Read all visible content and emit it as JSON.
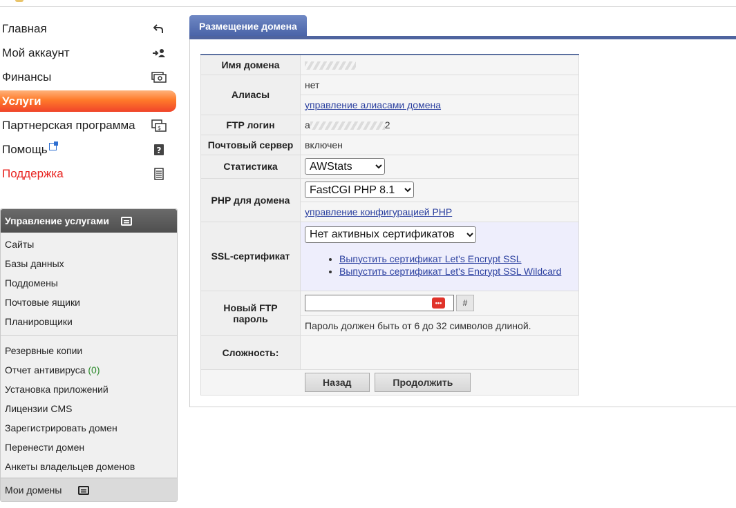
{
  "nav": {
    "items": [
      {
        "label": "Главная",
        "icon": "back-arrow-icon"
      },
      {
        "label": "Мой аккаунт",
        "icon": "user-login-icon"
      },
      {
        "label": "Финансы",
        "icon": "cash-icon"
      },
      {
        "label": "Услуги",
        "icon": "",
        "active": true
      },
      {
        "label": "Партнерская программа",
        "icon": "partner-icon"
      },
      {
        "label": "Помощь",
        "icon": "help-icon",
        "external": true
      },
      {
        "label": "Поддержка",
        "icon": "document-icon",
        "color": "#e8231f"
      }
    ]
  },
  "services": {
    "title": "Управление услугами",
    "group1": [
      "Сайты",
      "Базы данных",
      "Поддомены",
      "Почтовые ящики",
      "Планировщики"
    ],
    "group2": [
      "Резервные копии",
      "Отчет антивируса",
      "Установка приложений",
      "Лицензии CMS",
      "Зарегистрировать домен",
      "Перенести домен",
      "Анкеты владельцев доменов"
    ],
    "antivirus_count": "(0)",
    "footer": "Мои домены"
  },
  "tab": {
    "title": "Размещение домена"
  },
  "form": {
    "domain_label": "Имя домена",
    "aliases_label": "Алиасы",
    "aliases_value": "нет",
    "aliases_link": "управление алиасами домена",
    "ftp_login_label": "FTP логин",
    "ftp_login_prefix": "a",
    "ftp_login_suffix": "2",
    "mail_label": "Почтовый сервер",
    "mail_value": "включен",
    "stats_label": "Статистика",
    "stats_selected": "AWStats",
    "php_label": "PHP для домена",
    "php_selected": "FastCGI PHP 8.1",
    "php_link": "управление конфигурацией PHP",
    "ssl_label": "SSL-сертификат",
    "ssl_selected": "Нет активных сертификатов",
    "ssl_links": [
      "Выпустить сертификат Let's Encrypt SSL",
      "Выпустить сертификат Let's Encrypt SSL Wildcard"
    ],
    "ftp_pwd_label": "Новый FTP пароль",
    "ftp_pwd_hint": "Пароль должен быть от 6 до 32 символов длиной.",
    "ftp_pwd_gen": "#",
    "complexity_label": "Сложность:",
    "back_button": "Назад",
    "continue_button": "Продолжить"
  },
  "colors": {
    "accent": "#4f649f",
    "active_nav": "#f0442a",
    "link": "#2a3f9f",
    "support": "#e8231f"
  }
}
